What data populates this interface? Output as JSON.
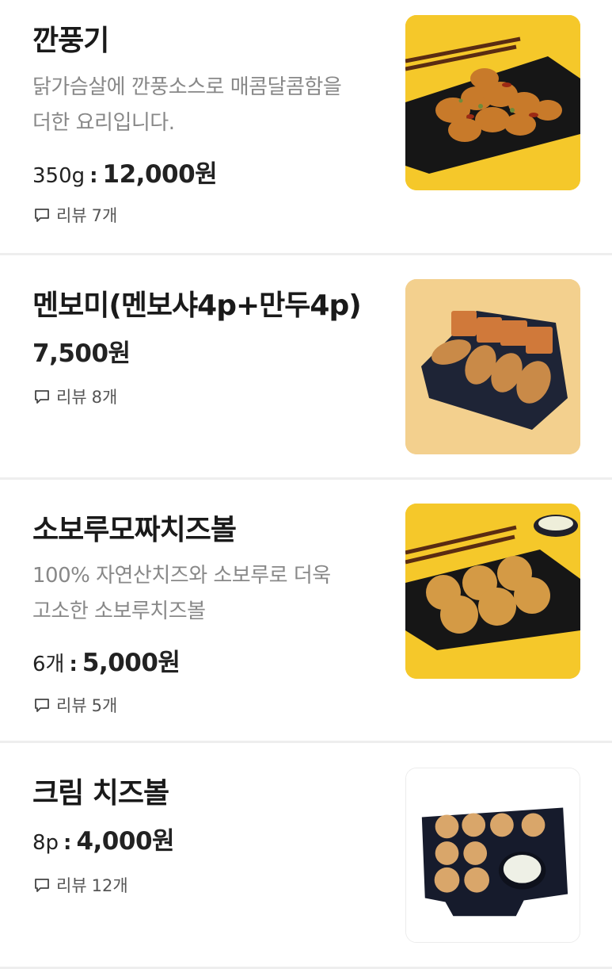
{
  "menu": {
    "review_label": "리뷰",
    "items": [
      {
        "name": "깐풍기",
        "description": "닭가슴살에 깐풍소스로 매콤달콤함을 더한 요리입니다.",
        "quantity": "350g",
        "separator": ":",
        "price": "12,000원",
        "review_count": "7개",
        "image_bg": "#f5c82a"
      },
      {
        "name": "멘보미(멘보샤4p+만두4p)",
        "description": "",
        "quantity": "",
        "separator": "",
        "price": "7,500원",
        "review_count": "8개",
        "image_bg": "#f3d08e"
      },
      {
        "name": "소보루모짜치즈볼",
        "description": "100% 자연산치즈와 소보루로 더욱 고소한 소보루치즈볼",
        "quantity": "6개",
        "separator": ":",
        "price": "5,000원",
        "review_count": "5개",
        "image_bg": "#f5c82a"
      },
      {
        "name": "크림 치즈볼",
        "description": "",
        "quantity": "8p",
        "separator": ":",
        "price": "4,000원",
        "review_count": "12개",
        "image_bg": "#ffffff"
      }
    ]
  }
}
